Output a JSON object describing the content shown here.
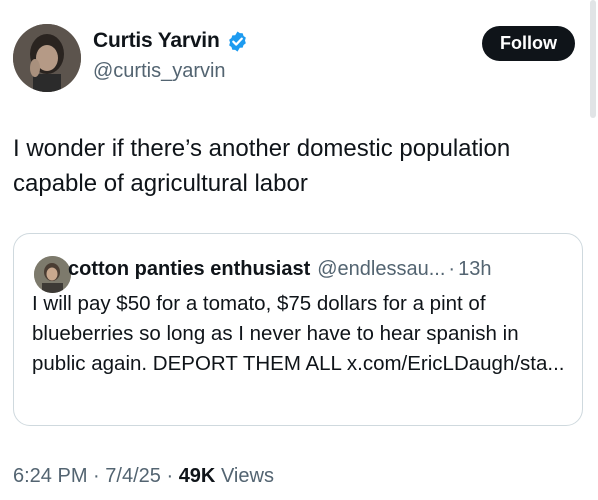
{
  "author": {
    "display_name": "Curtis Yarvin",
    "handle": "@curtis_yarvin",
    "verified_badge": "verified-badge-icon",
    "accent_color": "#1d9bf0"
  },
  "actions": {
    "follow_label": "Follow"
  },
  "tweet": {
    "text": "I wonder if there’s another domestic population capable of agricultural labor"
  },
  "quote": {
    "display_name": "cotton panties enthusiast",
    "handle": "@endlessau...",
    "separator": "·",
    "time": "13h",
    "text": "I will pay $50 for a tomato, $75 dollars for a pint of blueberries so long as I never have to hear spanish in public again. DEPORT THEM ALL x.com/​EricLDaugh/sta..."
  },
  "meta": {
    "time": "6:24 PM",
    "separator": "·",
    "date": "7/4/25",
    "views_count": "49K",
    "views_label": "Views"
  }
}
